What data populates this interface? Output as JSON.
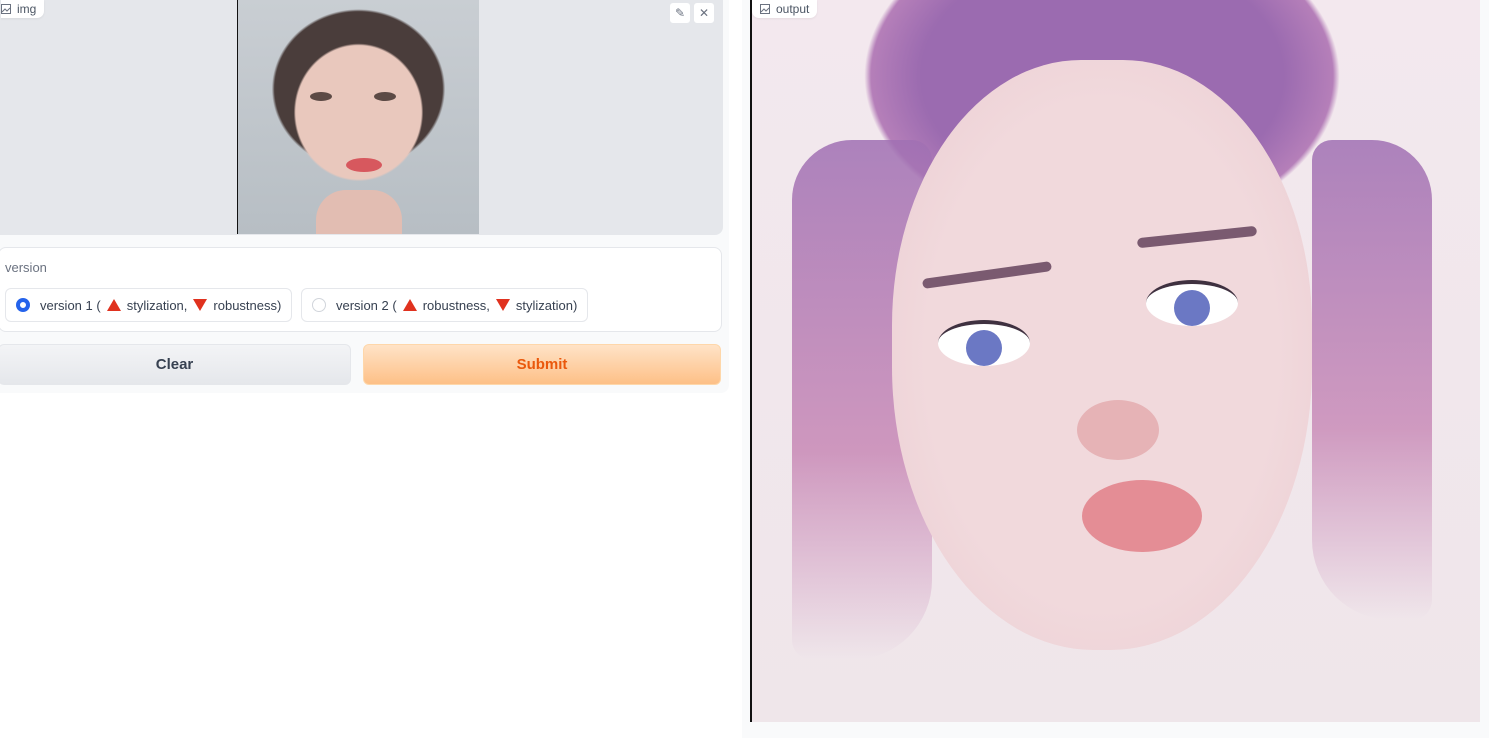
{
  "input": {
    "label": "img",
    "edit_icon": "pencil-icon",
    "close_icon": "close-icon"
  },
  "version": {
    "label": "version",
    "options": [
      {
        "prefix": "version 1 (",
        "part1": "stylization,",
        "part2": "robustness)",
        "selected": true
      },
      {
        "prefix": "version 2 (",
        "part1": "robustness,",
        "part2": "stylization)",
        "selected": false
      }
    ]
  },
  "actions": {
    "clear_label": "Clear",
    "submit_label": "Submit"
  },
  "output": {
    "label": "output"
  },
  "colors": {
    "accent": "#2563eb",
    "submit_text": "#ea580c",
    "triangle": "#e0321f"
  }
}
